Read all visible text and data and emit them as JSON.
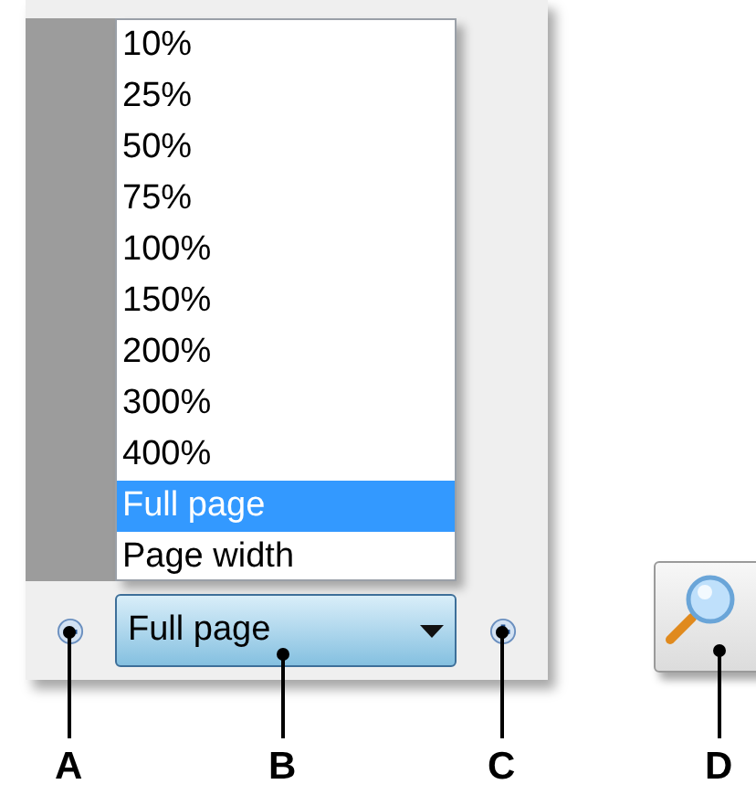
{
  "zoom_menu": {
    "items": [
      {
        "label": "10%",
        "selected": false
      },
      {
        "label": "25%",
        "selected": false
      },
      {
        "label": "50%",
        "selected": false
      },
      {
        "label": "75%",
        "selected": false
      },
      {
        "label": "100%",
        "selected": false
      },
      {
        "label": "150%",
        "selected": false
      },
      {
        "label": "200%",
        "selected": false
      },
      {
        "label": "300%",
        "selected": false
      },
      {
        "label": "400%",
        "selected": false
      },
      {
        "label": "Full page",
        "selected": true
      },
      {
        "label": "Page width",
        "selected": false
      }
    ]
  },
  "zoom_combo": {
    "value": "Full page"
  },
  "callouts": [
    {
      "label": "A"
    },
    {
      "label": "B"
    },
    {
      "label": "C"
    },
    {
      "label": "D"
    }
  ]
}
